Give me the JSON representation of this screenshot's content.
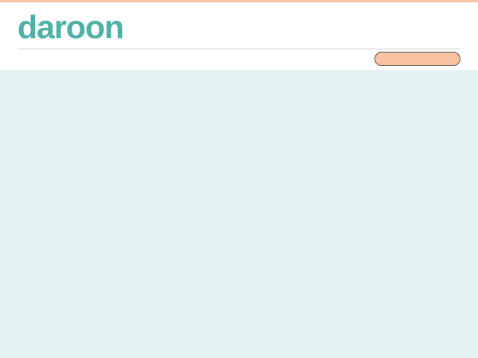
{
  "brand": {
    "name": "daroon",
    "logo_color": "#4fb0a6",
    "accent_color": "#f9c0a1",
    "top_strip_color": "#f7c4a4"
  },
  "header": {
    "button_label": ""
  },
  "page": {
    "background_color": "#e6f2f3"
  }
}
